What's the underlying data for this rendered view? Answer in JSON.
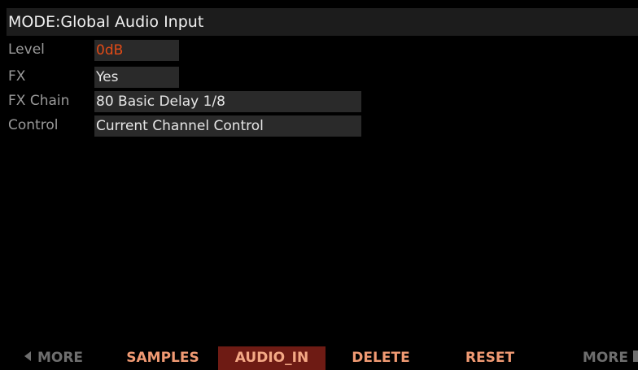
{
  "title": "MODE:Global Audio Input",
  "params": [
    {
      "label": "Level",
      "value": "0dB"
    },
    {
      "label": "FX",
      "value": "Yes"
    },
    {
      "label": "FX Chain",
      "value": "80 Basic Delay 1/8"
    },
    {
      "label": "Control",
      "value": "Current Channel Control"
    }
  ],
  "softbuttons": {
    "more_left": "MORE",
    "samples": "SAMPLES",
    "audio_in": "AUDIO_IN",
    "delete": "DELETE",
    "reset": "RESET",
    "more_right": "MORE"
  },
  "icons": {
    "more_left": "triangle-left-icon",
    "more_right": "triangle-right-icon"
  },
  "colors": {
    "level_value": "#e24b17",
    "softbutton_active": "#f09a73",
    "softbutton_selected_bg": "#6e1b14",
    "softbutton_inactive": "#6e6e6e"
  }
}
